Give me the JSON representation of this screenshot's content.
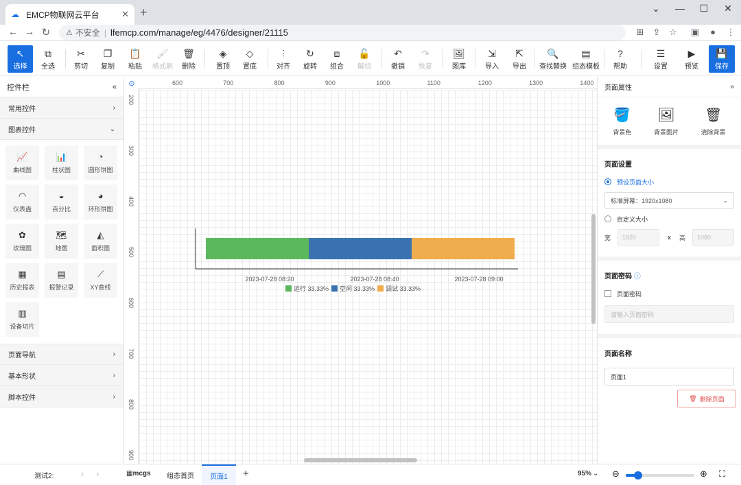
{
  "browser": {
    "tab_title": "EMCP物联网云平台",
    "insecure": "不安全",
    "url": "lfemcp.com/manage/eg/4476/designer/21115"
  },
  "toolbar": {
    "items": [
      {
        "label": "选择",
        "icon": "↖",
        "x": 11,
        "w": 37,
        "state": "selected"
      },
      {
        "label": "全选",
        "icon": "⧉",
        "x": 53,
        "w": 34
      },
      {
        "label": "剪切",
        "icon": "✂",
        "x": 101,
        "w": 34
      },
      {
        "label": "复制",
        "icon": "❐",
        "x": 140,
        "w": 34
      },
      {
        "label": "粘贴",
        "icon": "📋",
        "x": 180,
        "w": 34
      },
      {
        "label": "格式刷",
        "icon": "🖌",
        "x": 219,
        "w": 36,
        "state": "disabled"
      },
      {
        "label": "删除",
        "icon": "🗑",
        "x": 258,
        "w": 34
      },
      {
        "label": "置顶",
        "icon": "◈",
        "x": 308,
        "w": 34
      },
      {
        "label": "置底",
        "icon": "◇",
        "x": 347,
        "w": 34
      },
      {
        "label": "对齐",
        "icon": "⫶",
        "x": 396,
        "w": 34
      },
      {
        "label": "旋转",
        "icon": "↻",
        "x": 435,
        "w": 34
      },
      {
        "label": "组合",
        "icon": "⧈",
        "x": 474,
        "w": 34
      },
      {
        "label": "解组",
        "icon": "🔓",
        "x": 514,
        "w": 34,
        "state": "disabled"
      },
      {
        "label": "撤销",
        "icon": "↶",
        "x": 563,
        "w": 34
      },
      {
        "label": "恢复",
        "icon": "↷",
        "x": 603,
        "w": 34,
        "state": "disabled"
      },
      {
        "label": "图库",
        "icon": "🖼",
        "x": 652,
        "w": 34
      },
      {
        "label": "导入",
        "icon": "⇲",
        "x": 700,
        "w": 34
      },
      {
        "label": "导出",
        "icon": "⇱",
        "x": 740,
        "w": 34
      },
      {
        "label": "查找替换",
        "icon": "🔍",
        "x": 785,
        "w": 42
      },
      {
        "label": "组态模板",
        "icon": "▤",
        "x": 833,
        "w": 42
      },
      {
        "label": "帮助",
        "icon": "?",
        "x": 887,
        "w": 34
      },
      {
        "label": "设置",
        "icon": "☰",
        "x": 946,
        "w": 34
      },
      {
        "label": "预览",
        "icon": "▶",
        "x": 991,
        "w": 34
      },
      {
        "label": "保存",
        "icon": "💾",
        "x": 1033,
        "w": 38,
        "state": "save"
      }
    ]
  },
  "left_panel": {
    "title": "控件栏",
    "sections_top": [
      {
        "label": "常用控件",
        "expanded": false
      },
      {
        "label": "图表控件",
        "expanded": true
      }
    ],
    "chart_widgets": [
      {
        "label": "曲线图",
        "icon": "📈"
      },
      {
        "label": "柱状图",
        "icon": "📊"
      },
      {
        "label": "圆形饼图",
        "icon": "◔"
      },
      {
        "label": "仪表盘",
        "icon": "◠"
      },
      {
        "label": "百分比",
        "icon": "◒"
      },
      {
        "label": "环形饼图",
        "icon": "◕"
      },
      {
        "label": "玫瑰图",
        "icon": "✿"
      },
      {
        "label": "地图",
        "icon": "🗺"
      },
      {
        "label": "面积图",
        "icon": "◭"
      },
      {
        "label": "历史报表",
        "icon": "▦"
      },
      {
        "label": "报警记录",
        "icon": "▤"
      },
      {
        "label": "XY曲线",
        "icon": "⟋"
      },
      {
        "label": "设备切片",
        "icon": "▥"
      }
    ],
    "sections_bottom": [
      {
        "label": "页面导航"
      },
      {
        "label": "基本形状"
      },
      {
        "label": "脚本控件"
      }
    ]
  },
  "ruler": {
    "top": [
      "600",
      "700",
      "800",
      "900",
      "1000",
      "1100",
      "1200",
      "1300",
      "1400"
    ],
    "left": [
      "200",
      "300",
      "400",
      "500",
      "600",
      "700",
      "800",
      "900"
    ]
  },
  "chart_data": {
    "type": "bar",
    "orientation": "horizontal-stacked",
    "x_ticks": [
      "2023-07-28 08:20",
      "2023-07-28 08:40",
      "2023-07-28 09:00"
    ],
    "series": [
      {
        "name": "运行",
        "value": 33.33,
        "legend": "运行 33.33%",
        "color": "#5cb85c"
      },
      {
        "name": "空闲",
        "value": 33.33,
        "legend": "空闲 33.33%",
        "color": "#3a72b0"
      },
      {
        "name": "调试",
        "value": 33.33,
        "legend": "调试 33.33%",
        "color": "#f0ad4e"
      }
    ]
  },
  "right_panel": {
    "title": "页面属性",
    "bg_buttons": [
      {
        "label": "背景色",
        "icon": "🪣"
      },
      {
        "label": "背景图片",
        "icon": "🖼"
      },
      {
        "label": "清除背景",
        "icon": "🗑"
      }
    ],
    "page_settings": {
      "title": "页面设置",
      "preset_label": "预设页面大小",
      "preset_value": "标准屏幕：1920x1080",
      "custom_label": "自定义大小",
      "width_label": "宽",
      "width_value": "1920",
      "x_sep": "x",
      "height_label": "高",
      "height_value": "1080"
    },
    "page_password": {
      "title": "页面密码",
      "check_label": "页面密码",
      "placeholder": "请输入页面密码"
    },
    "page_name": {
      "title": "页面名称",
      "value": "页面1"
    },
    "delete_label": "删除页面"
  },
  "bottom_bar": {
    "label": "测试2:",
    "pages": [
      "mcgs",
      "组态首页",
      "页面1"
    ],
    "active_page": "页面1",
    "zoom": "95%",
    "zoom_level": 0.18
  }
}
